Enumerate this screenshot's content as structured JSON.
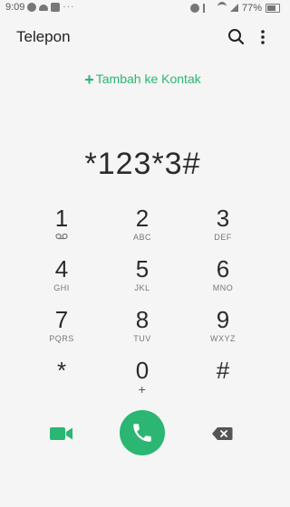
{
  "status_bar": {
    "time": "9:09",
    "battery": "77%"
  },
  "app_bar": {
    "title": "Telepon"
  },
  "add_contact": {
    "label": "Tambah ke Kontak"
  },
  "dial_display": {
    "number": "*123*3#"
  },
  "keypad": [
    {
      "digit": "1",
      "letters": ""
    },
    {
      "digit": "2",
      "letters": "ABC"
    },
    {
      "digit": "3",
      "letters": "DEF"
    },
    {
      "digit": "4",
      "letters": "GHI"
    },
    {
      "digit": "5",
      "letters": "JKL"
    },
    {
      "digit": "6",
      "letters": "MNO"
    },
    {
      "digit": "7",
      "letters": "PQRS"
    },
    {
      "digit": "8",
      "letters": "TUV"
    },
    {
      "digit": "9",
      "letters": "WXYZ"
    },
    {
      "digit": "*",
      "letters": ""
    },
    {
      "digit": "0",
      "letters": "+"
    },
    {
      "digit": "#",
      "letters": ""
    }
  ],
  "colors": {
    "accent": "#2bb673",
    "background": "#f5f5f5",
    "text": "#2b2b2b"
  },
  "icons": {
    "search": "search-icon",
    "menu": "more-vert-icon",
    "video": "video-call-icon",
    "call": "phone-icon",
    "backspace": "backspace-icon",
    "voicemail": "voicemail-icon"
  }
}
